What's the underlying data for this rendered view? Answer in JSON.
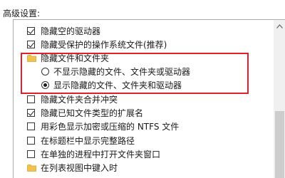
{
  "section_label": "高级设置:",
  "items": [
    {
      "kind": "checkbox",
      "checked": true,
      "label": "隐藏空的驱动器"
    },
    {
      "kind": "checkbox",
      "checked": true,
      "label": "隐藏受保护的操作系统文件(推荐)"
    },
    {
      "kind": "folder",
      "label": "隐藏文件和文件夹"
    },
    {
      "kind": "radio",
      "selected": false,
      "label": "不显示隐藏的文件、文件夹或驱动器"
    },
    {
      "kind": "radio",
      "selected": true,
      "label": "显示隐藏的文件、文件夹和驱动器"
    },
    {
      "kind": "checkbox",
      "checked": false,
      "label": "隐藏文件夹合并冲突"
    },
    {
      "kind": "checkbox",
      "checked": true,
      "label": "隐藏已知文件类型的扩展名"
    },
    {
      "kind": "checkbox",
      "checked": false,
      "label": "用彩色显示加密或压缩的 NTFS 文件"
    },
    {
      "kind": "checkbox",
      "checked": false,
      "label": "在标题栏中显示完整路径"
    },
    {
      "kind": "checkbox",
      "checked": false,
      "label": "在单独的进程中打开文件夹窗口"
    },
    {
      "kind": "folder",
      "label": "在列表视图中键入时"
    }
  ],
  "colors": {
    "highlight": "#e0202a",
    "folder": "#f2c24e"
  },
  "icons": {
    "folder": "folder-icon",
    "scroll_up": "scroll-up-arrow-icon"
  }
}
